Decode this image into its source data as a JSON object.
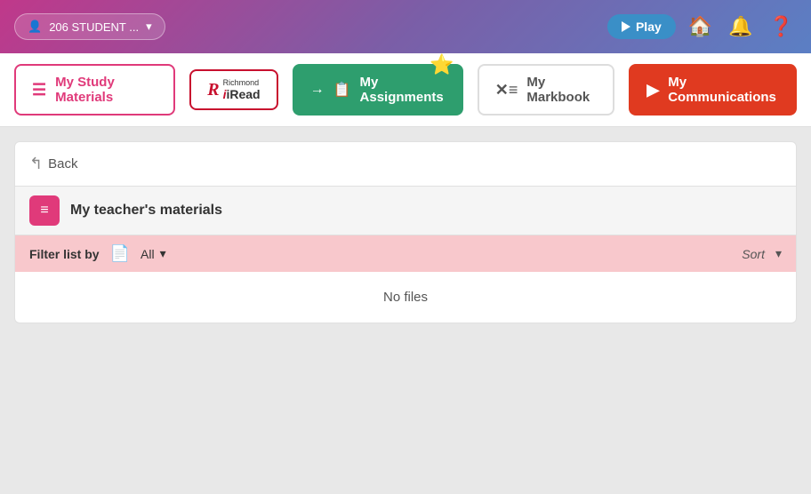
{
  "header": {
    "user_label": "206 STUDENT ...",
    "play_label": "Play",
    "dropdown_arrow": "▾"
  },
  "nav": {
    "study_materials": "My Study Materials",
    "iread_brand": "iRead",
    "iread_prefix": "Richmond",
    "assignments": "My Assignments",
    "markbook": "My Markbook",
    "communications": "My Communications",
    "star_emoji": "⭐"
  },
  "content": {
    "back_label": "Back",
    "teacher_materials_title": "My teacher's materials",
    "filter_label": "Filter list by",
    "filter_value": "All",
    "sort_label": "Sort",
    "no_files_label": "No files"
  },
  "icons": {
    "user": "👤",
    "home": "🏠",
    "bell": "🔔",
    "help": "❓",
    "back_arrow": "↑",
    "list_icon": "≡",
    "document": "📄"
  }
}
